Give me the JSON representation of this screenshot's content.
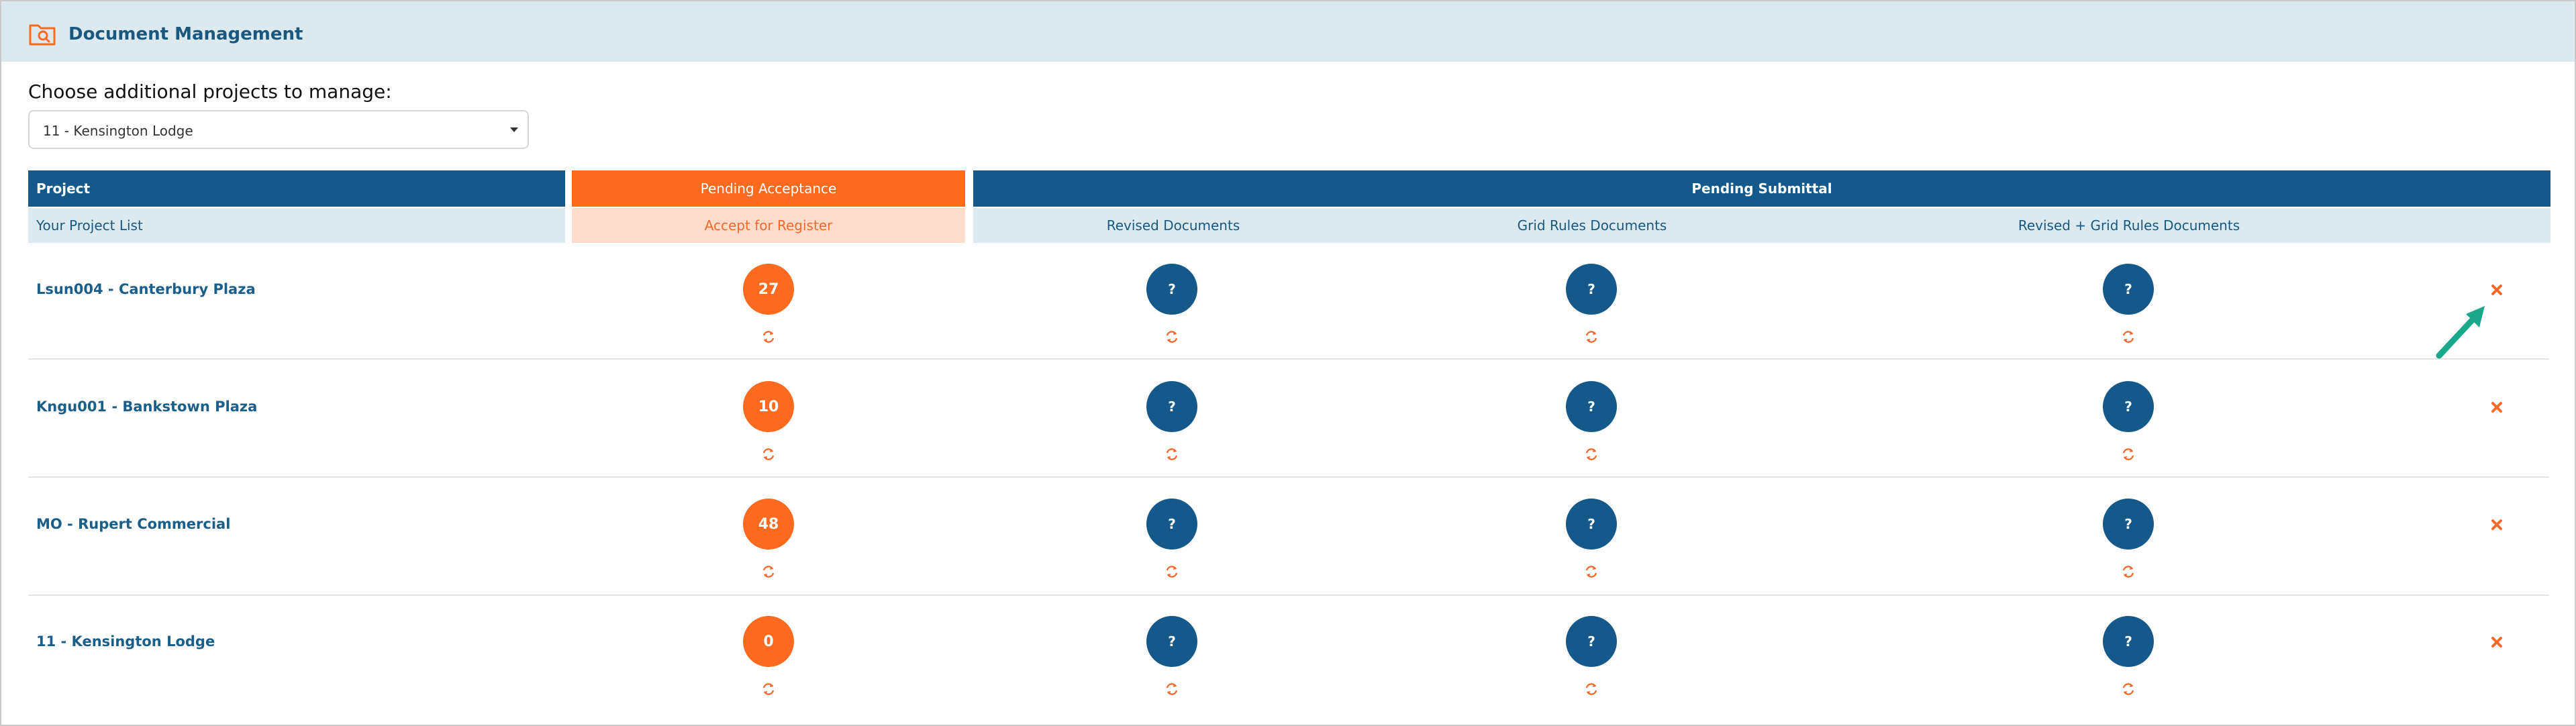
{
  "header": {
    "title": "Document Management",
    "icon": "folder-search-icon"
  },
  "choose": {
    "label": "Choose additional projects to manage:",
    "selected": "11 - Kensington Lodge"
  },
  "table": {
    "group_headers": {
      "project": "Project",
      "pending_acceptance": "Pending Acceptance",
      "pending_submittal": "Pending Submittal"
    },
    "sub_headers": {
      "your_project_list": "Your Project List",
      "accept_for_register": "Accept for Register",
      "revised_documents": "Revised Documents",
      "grid_rules_documents": "Grid Rules Documents",
      "revised_grid_rules_documents": "Revised + Grid Rules Documents"
    },
    "rows": [
      {
        "project": "Lsun004 - Canterbury Plaza",
        "accept": "27",
        "revised": "?",
        "grid": "?",
        "revised_grid": "?"
      },
      {
        "project": "Kngu001 - Bankstown Plaza",
        "accept": "10",
        "revised": "?",
        "grid": "?",
        "revised_grid": "?"
      },
      {
        "project": "MO - Rupert Commercial",
        "accept": "48",
        "revised": "?",
        "grid": "?",
        "revised_grid": "?"
      },
      {
        "project": "11 - Kensington Lodge",
        "accept": "0",
        "revised": "?",
        "grid": "?",
        "revised_grid": "?"
      }
    ]
  },
  "colors": {
    "brand_blue": "#14598a",
    "accent_orange": "#fc6a1f",
    "light_blue": "#dce9ef",
    "peach": "#fddccc",
    "annotation_arrow": "#1aa88a"
  },
  "icons": {
    "refresh": "refresh-icon",
    "remove": "close-icon",
    "annotation": "arrow-icon"
  }
}
